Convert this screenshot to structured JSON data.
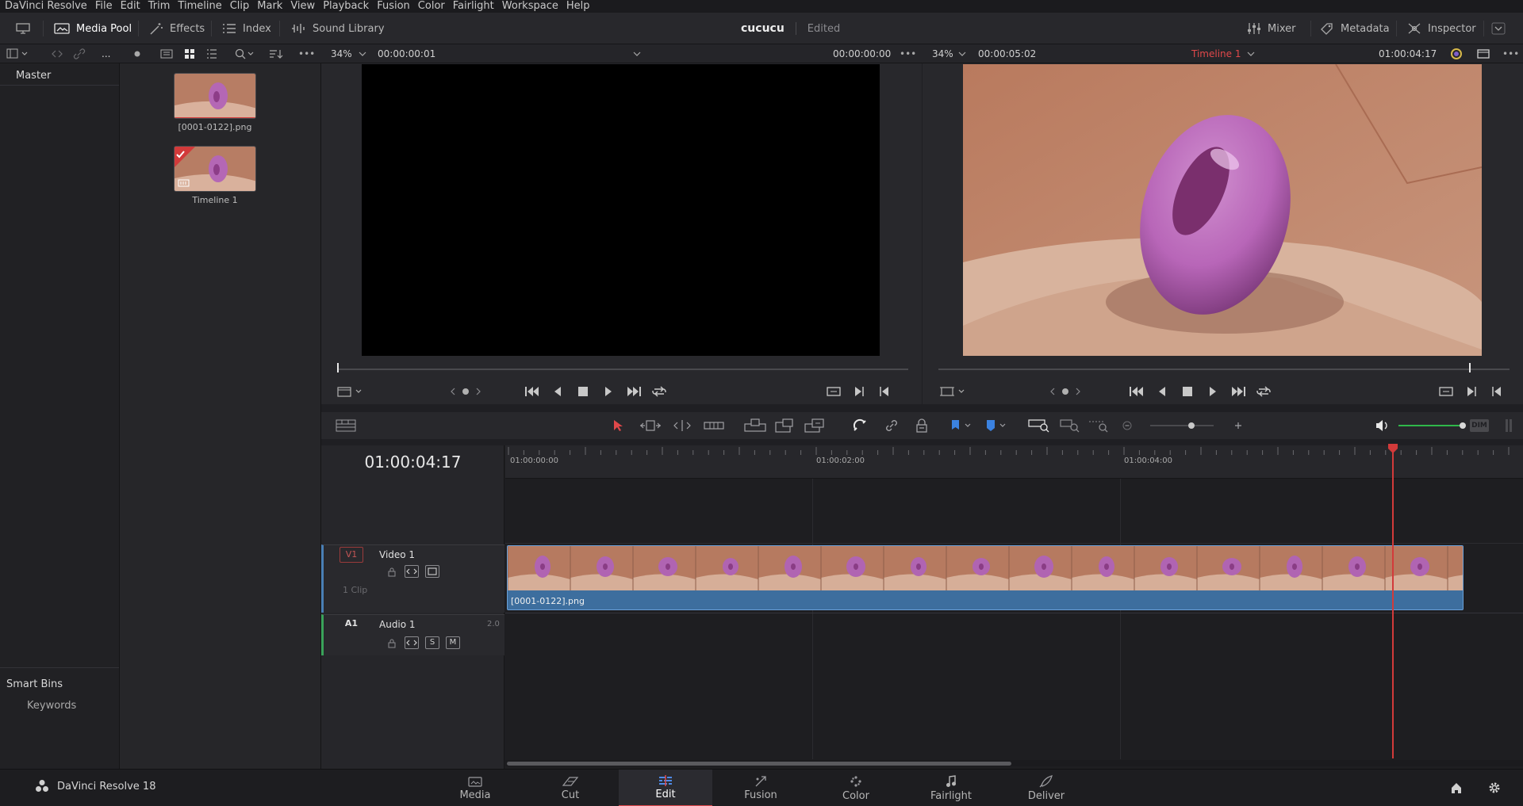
{
  "menu": [
    "DaVinci Resolve",
    "File",
    "Edit",
    "Trim",
    "Timeline",
    "Clip",
    "Mark",
    "View",
    "Playback",
    "Fusion",
    "Color",
    "Fairlight",
    "Workspace",
    "Help"
  ],
  "toolbar": {
    "media_pool": "Media Pool",
    "effects": "Effects",
    "index": "Index",
    "sound_library": "Sound Library",
    "project_name": "cucucu",
    "project_status": "Edited",
    "mixer": "Mixer",
    "metadata": "Metadata",
    "inspector": "Inspector"
  },
  "subbar": {
    "ellipsis": "...",
    "source_zoom": "34%",
    "source_duration": "00:00:00:01",
    "source_timecode": "00:00:00:00",
    "record_zoom": "34%",
    "record_duration": "00:00:05:02",
    "timeline_name": "Timeline 1",
    "record_timecode": "01:00:04:17"
  },
  "bins": {
    "master": "Master",
    "smart_bins": "Smart Bins",
    "keywords": "Keywords"
  },
  "media_pool": {
    "clips": [
      {
        "label": "[0001-0122].png"
      },
      {
        "label": "Timeline 1"
      }
    ]
  },
  "timeline": {
    "timecode": "01:00:04:17",
    "ruler_labels": [
      "01:00:00:00",
      "01:00:02:00",
      "01:00:04:00"
    ],
    "video_track": {
      "tag": "V1",
      "name": "Video 1",
      "clip_count": "1 Clip"
    },
    "audio_track": {
      "tag": "A1",
      "name": "Audio 1",
      "channels": "2.0",
      "solo": "S",
      "mute": "M"
    },
    "clip_name": "[0001-0122].png",
    "volume_label": "DIM"
  },
  "pages": {
    "brand": "DaVinci Resolve 18",
    "tabs": [
      "Media",
      "Cut",
      "Edit",
      "Fusion",
      "Color",
      "Fairlight",
      "Deliver"
    ],
    "active": "Edit"
  },
  "colors": {
    "accent_red": "#e0484a",
    "clip_blue": "#3d6e9e",
    "video_track_accent": "#4a7fb5",
    "audio_track_accent": "#3aa35a",
    "volume_green": "#2fb84a"
  }
}
